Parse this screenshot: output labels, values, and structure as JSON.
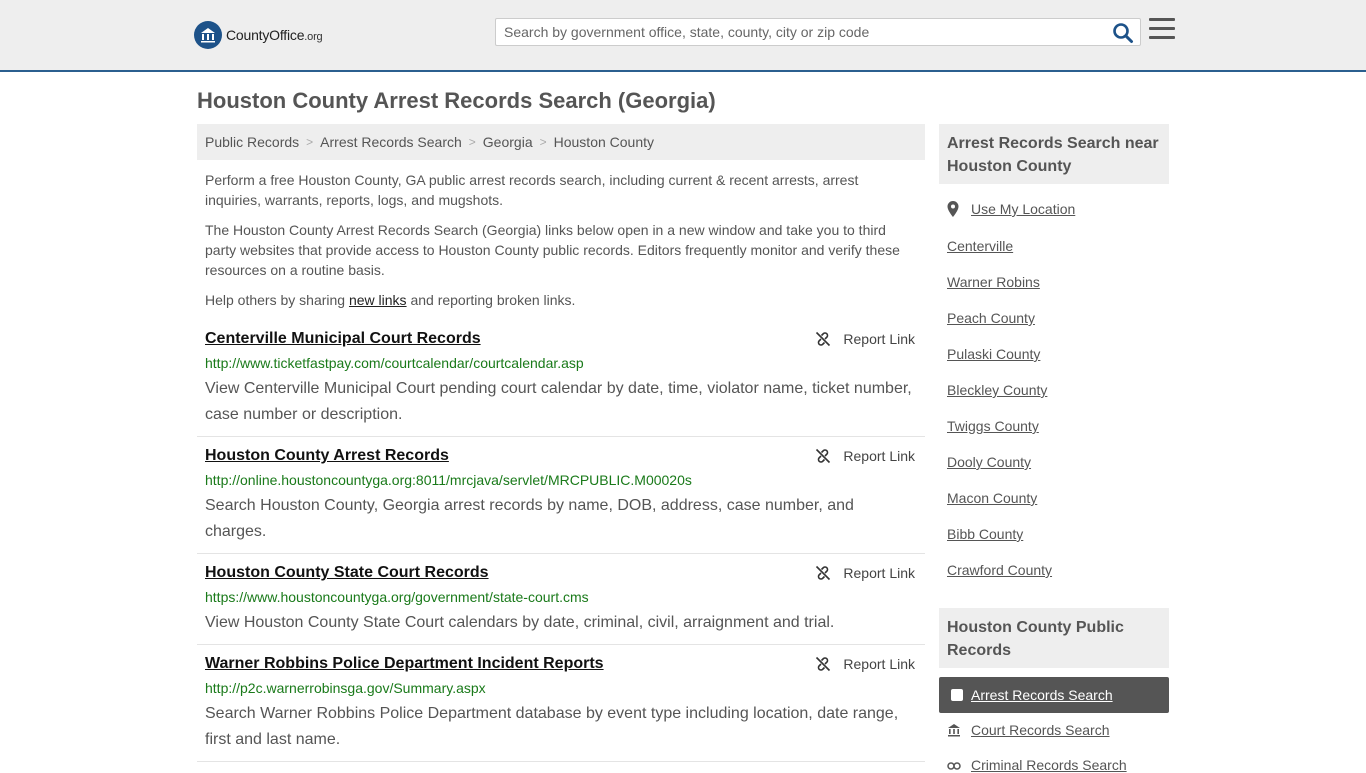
{
  "header": {
    "logo_county": "County",
    "logo_office": "Office",
    "logo_org": ".org",
    "search_placeholder": "Search by government office, state, county, city or zip code",
    "icons": {
      "search": "search-icon",
      "menu": "hamburger-menu-icon"
    }
  },
  "page": {
    "title": "Houston County Arrest Records Search (Georgia)"
  },
  "breadcrumb": [
    "Public Records",
    "Arrest Records Search",
    "Georgia",
    "Houston County"
  ],
  "intro": {
    "p1": "Perform a free Houston County, GA public arrest records search, including current & recent arrests, arrest inquiries, warrants, reports, logs, and mugshots.",
    "p2": "The Houston County Arrest Records Search (Georgia) links below open in a new window and take you to third party websites that provide access to Houston County public records. Editors frequently monitor and verify these resources on a routine basis.",
    "p3_before": "Help others by sharing ",
    "p3_link": "new links",
    "p3_after": " and reporting broken links."
  },
  "listings": [
    {
      "title": "Centerville Municipal Court Records",
      "url": "http://www.ticketfastpay.com/courtcalendar/courtcalendar.asp",
      "desc": "View Centerville Municipal Court pending court calendar by date, time, violator name, ticket number, case number or description.",
      "report": "Report Link"
    },
    {
      "title": "Houston County Arrest Records",
      "url": "http://online.houstoncountyga.org:8011/mrcjava/servlet/MRCPUBLIC.M00020s",
      "desc": "Search Houston County, Georgia arrest records by name, DOB, address, case number, and charges.",
      "report": "Report Link"
    },
    {
      "title": "Houston County State Court Records",
      "url": "https://www.houstoncountyga.org/government/state-court.cms",
      "desc": "View Houston County State Court calendars by date, criminal, civil, arraignment and trial.",
      "report": "Report Link"
    },
    {
      "title": "Warner Robbins Police Department Incident Reports",
      "url": "http://p2c.warnerrobinsga.gov/Summary.aspx",
      "desc": "Search Warner Robbins Police Department database by event type including location, date range, first and last name.",
      "report": "Report Link"
    }
  ],
  "sidebar": {
    "near_title": "Arrest Records Search near Houston County",
    "use_location": "Use My Location",
    "near_links": [
      "Centerville",
      "Warner Robins",
      "Peach County",
      "Pulaski County",
      "Bleckley County",
      "Twiggs County",
      "Dooly County",
      "Macon County",
      "Bibb County",
      "Crawford County"
    ],
    "public_title": "Houston County Public Records",
    "public_links": [
      "Arrest Records Search",
      "Court Records Search",
      "Criminal Records Search"
    ]
  },
  "colors": {
    "brand_blue": "#1d5289",
    "url_green": "#1a7a1a",
    "active_bg": "#555555"
  }
}
